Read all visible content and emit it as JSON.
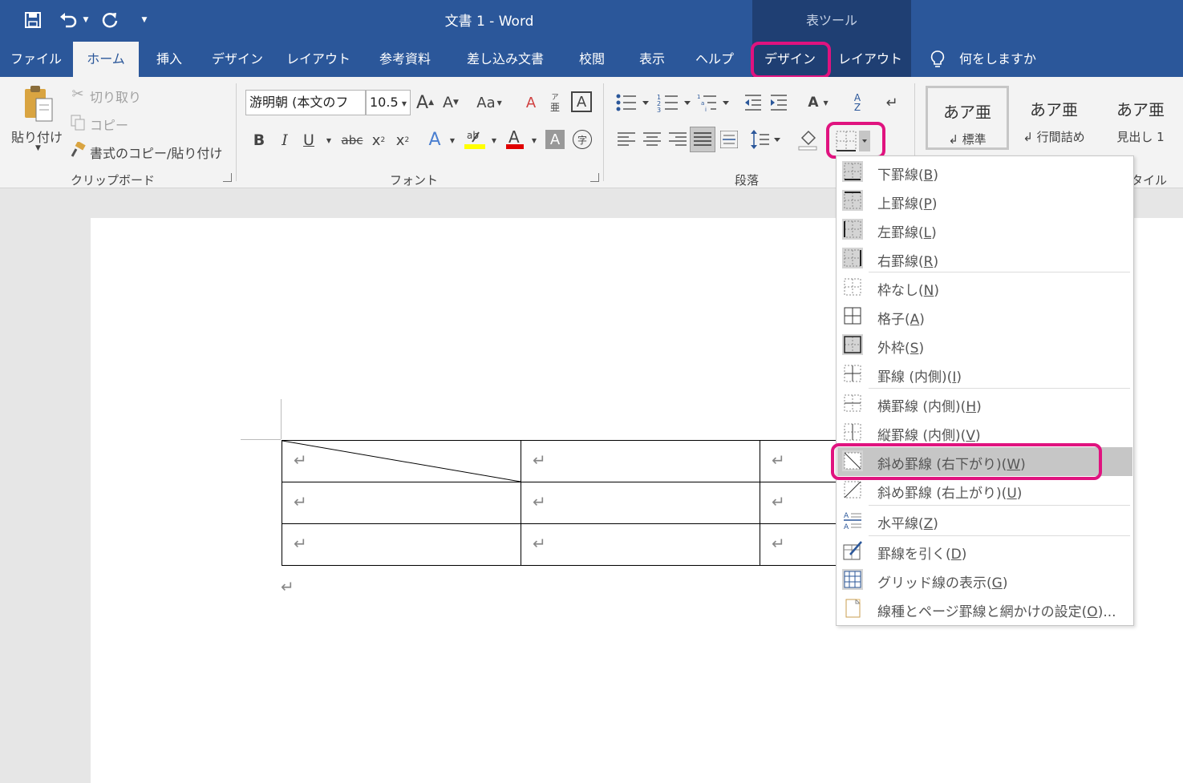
{
  "titlebar": {
    "doc_title": "文書 1  -  Word",
    "contextual_title": "表ツール"
  },
  "tabs": [
    "ファイル",
    "ホーム",
    "挿入",
    "デザイン",
    "レイアウト",
    "参考資料",
    "差し込み文書",
    "校閲",
    "表示",
    "ヘルプ",
    "デザイン",
    "レイアウト"
  ],
  "tell_me": "何をしますか",
  "clipboard": {
    "paste": "貼り付け",
    "cut": "切り取り",
    "copy": "コピー",
    "format_painter": "書式のコピー/貼り付け",
    "label": "クリップボード"
  },
  "font": {
    "name": "游明朝 (本文のフ",
    "size": "10.5",
    "label": "フォント"
  },
  "paragraph": {
    "label": "段落"
  },
  "styles": {
    "items": [
      {
        "preview": "あア亜",
        "name": "↲ 標準"
      },
      {
        "preview": "あア亜",
        "name": "↲ 行間詰め"
      },
      {
        "preview": "あア亜",
        "name": "見出し 1"
      }
    ],
    "label": "タイル"
  },
  "menu": {
    "items": [
      {
        "label": "下罫線(B)",
        "key": "B",
        "pre": "下罫線(",
        "post": ")",
        "icon": "bottom-border-icon"
      },
      {
        "label": "上罫線(P)",
        "key": "P",
        "pre": "上罫線(",
        "post": ")",
        "icon": "top-border-icon"
      },
      {
        "label": "左罫線(L)",
        "key": "L",
        "pre": "左罫線(",
        "post": ")",
        "icon": "left-border-icon"
      },
      {
        "label": "右罫線(R)",
        "key": "R",
        "pre": "右罫線(",
        "post": ")",
        "icon": "right-border-icon"
      },
      {
        "label": "枠なし(N)",
        "key": "N",
        "pre": "枠なし(",
        "post": ")",
        "icon": "no-border-icon"
      },
      {
        "label": "格子(A)",
        "key": "A",
        "pre": "格子(",
        "post": ")",
        "icon": "all-borders-icon"
      },
      {
        "label": "外枠(S)",
        "key": "S",
        "pre": "外枠(",
        "post": ")",
        "icon": "outside-borders-icon"
      },
      {
        "label": "罫線 (内側)(I)",
        "key": "I",
        "pre": "罫線 (内側)(",
        "post": ")",
        "icon": "inside-borders-icon"
      },
      {
        "label": "横罫線 (内側)(H)",
        "key": "H",
        "pre": "横罫線 (内側)(",
        "post": ")",
        "icon": "inside-horizontal-border-icon"
      },
      {
        "label": "縦罫線 (内側)(V)",
        "key": "V",
        "pre": "縦罫線 (内側)(",
        "post": ")",
        "icon": "inside-vertical-border-icon"
      },
      {
        "label": "斜め罫線 (右下がり)(W)",
        "key": "W",
        "pre": "斜め罫線 (右下がり)(",
        "post": ")",
        "icon": "diagonal-down-border-icon"
      },
      {
        "label": "斜め罫線 (右上がり)(U)",
        "key": "U",
        "pre": "斜め罫線 (右上がり)(",
        "post": ")",
        "icon": "diagonal-up-border-icon"
      },
      {
        "label": "水平線(Z)",
        "key": "Z",
        "pre": "水平線(",
        "post": ")",
        "icon": "horizontal-line-icon"
      },
      {
        "label": "罫線を引く(D)",
        "key": "D",
        "pre": "罫線を引く(",
        "post": ")",
        "icon": "draw-table-icon"
      },
      {
        "label": "グリッド線の表示(G)",
        "key": "G",
        "pre": "グリッド線の表示(",
        "post": ")",
        "icon": "view-gridlines-icon"
      },
      {
        "label": "線種とページ罫線と網かけの設定(O)...",
        "key": "O",
        "pre": "線種とページ罫線と網かけの設定(",
        "post": ")...",
        "icon": "borders-shading-icon"
      }
    ],
    "selected": 10
  },
  "document": {
    "return_mark": "↵"
  },
  "colors": {
    "title_bar": "#2b579a",
    "highlight_ring": "#e0137f",
    "ribbon": "#f3f3f3"
  }
}
